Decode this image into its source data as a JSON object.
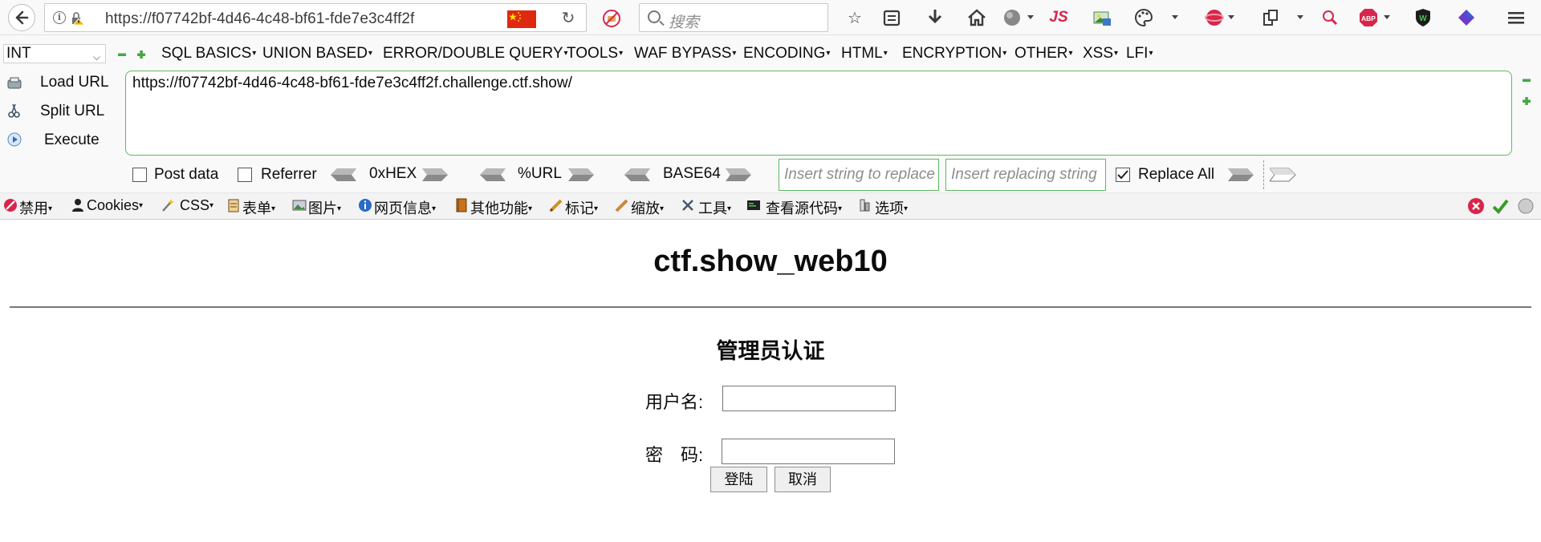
{
  "browser": {
    "url": "https://f07742bf-4d46-4c48-bf61-fde7e3c4ff2f",
    "search_placeholder": "搜索",
    "toolbar_icons": [
      "star-icon",
      "clipboard-icon",
      "download-icon",
      "home-icon",
      "globe-icon",
      "js-icon",
      "image-icon",
      "palette-icon",
      "flame-icon",
      "screenshot-icon",
      "magnify-icon",
      "adblock-icon",
      "shield-icon",
      "cube-icon",
      "menu-icon"
    ],
    "adblock_label": "ABP",
    "js_label": "JS"
  },
  "hackbar": {
    "type_select": "INT",
    "menus": [
      "SQL BASICS",
      "UNION BASED",
      "ERROR/DOUBLE QUERY",
      "TOOLS",
      "WAF BYPASS",
      "ENCODING",
      "HTML",
      "ENCRYPTION",
      "OTHER",
      "XSS",
      "LFI"
    ],
    "load_url": "Load URL",
    "split_url": "Split URL",
    "execute": "Execute",
    "url_value": "https://f07742bf-4d46-4c48-bf61-fde7e3c4ff2f.challenge.ctf.show/",
    "post_data": "Post data",
    "referrer": "Referrer",
    "hex": "0xHEX",
    "urlenc": "%URL",
    "base64": "BASE64",
    "insert_placeholder": "Insert string to replace",
    "replacing_placeholder": "Insert replacing string",
    "replace_all": "Replace All",
    "replace_all_checked": true
  },
  "webdev_toolbar": {
    "items": [
      "禁用",
      "Cookies",
      "CSS",
      "表单",
      "图片",
      "网页信息",
      "其他功能",
      "标记",
      "缩放",
      "工具",
      "查看源代码",
      "选项"
    ]
  },
  "page": {
    "title": "ctf.show_web10",
    "subtitle": "管理员认证",
    "username_label": "用户名:",
    "password_label": "密　码:",
    "login_button": "登陆",
    "cancel_button": "取消"
  }
}
